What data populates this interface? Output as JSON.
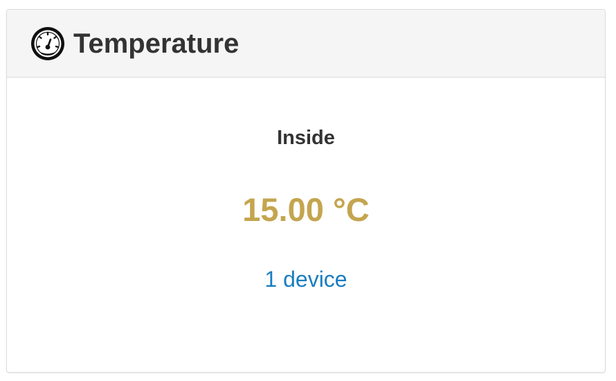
{
  "panel": {
    "title": "Temperature",
    "icon": "gauge-icon"
  },
  "sensor": {
    "location": "Inside",
    "value": "15.00 °C",
    "device_link": "1 device"
  },
  "colors": {
    "value": "#c4a54f",
    "link": "#1a7dc0"
  }
}
